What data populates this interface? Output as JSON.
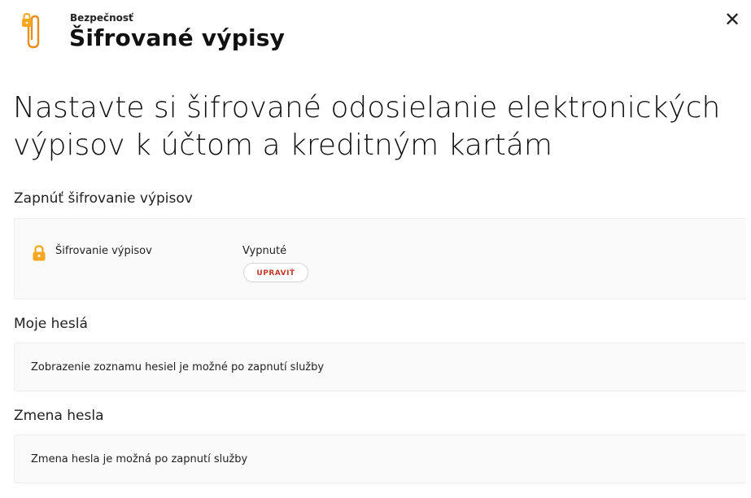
{
  "header": {
    "kicker": "Bezpečnosť",
    "title": "Šifrované výpisy",
    "close_label": "✕",
    "icon": "paperclip-lock-icon",
    "accent": "#e8901e"
  },
  "headline": "Nastavte si šifrované odosielanie elektronických výpisov k účtom a kreditným kartám",
  "sections": {
    "encryption": {
      "title": "Zapnúť šifrovanie výpisov",
      "row_label": "Šifrovanie výpisov",
      "status": "Vypnuté",
      "edit_label": "UPRAVIŤ",
      "icon": "lock-icon"
    },
    "passwords": {
      "title": "Moje heslá",
      "message": "Zobrazenie zoznamu hesiel je možné po zapnutí služby"
    },
    "password_change": {
      "title": "Zmena hesla",
      "message": "Zmena hesla je možná po zapnutí služby"
    }
  },
  "colors": {
    "accent_orange": "#f5a623",
    "link_red": "#c0392b",
    "panel_bg": "#fafafa"
  }
}
